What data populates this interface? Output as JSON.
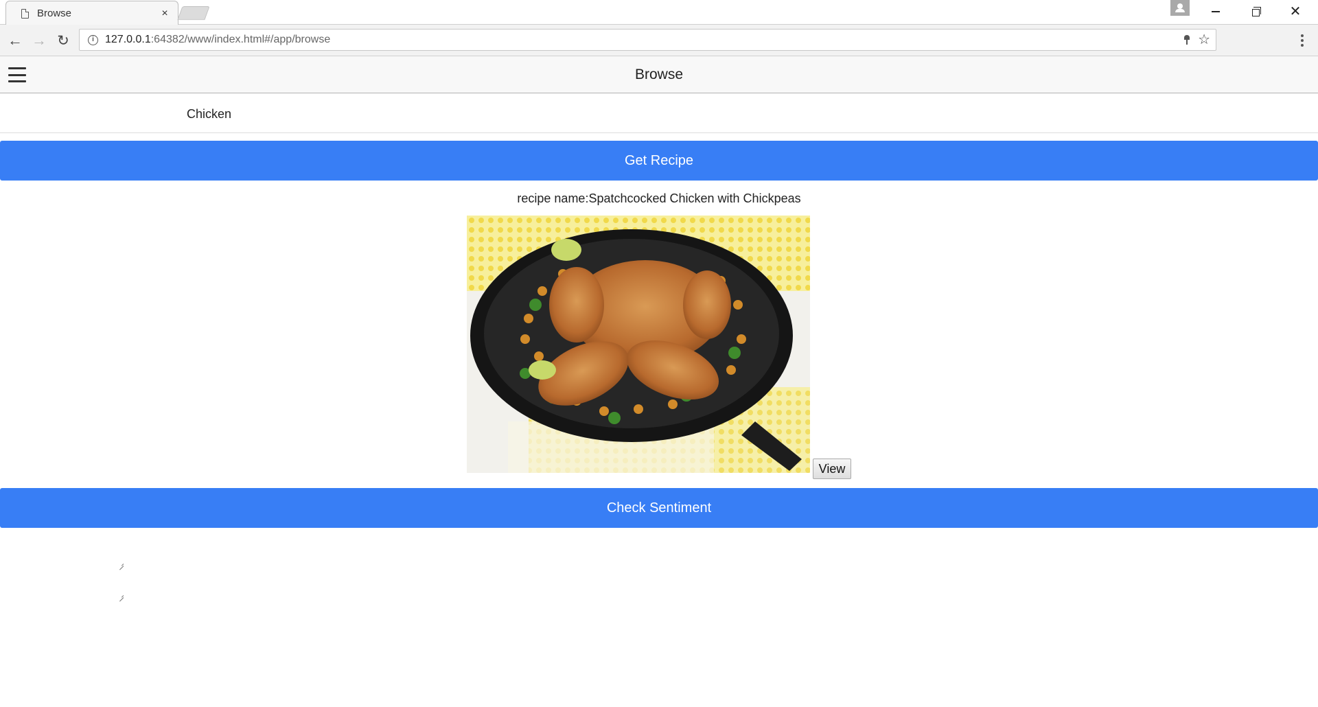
{
  "browser": {
    "tab_title": "Browse",
    "tab_close": "×",
    "url_host": "127.0.0.1",
    "url_rest": ":64382/www/index.html#/app/browse",
    "info_glyph": "i",
    "star_glyph": "☆",
    "back_glyph": "←",
    "forward_glyph": "→",
    "reload_glyph": "↻",
    "close_glyph": "✕"
  },
  "header": {
    "title": "Browse"
  },
  "search": {
    "value": "Chicken"
  },
  "buttons": {
    "get_recipe": "Get Recipe",
    "check_sentiment": "Check Sentiment",
    "view": "View"
  },
  "recipe": {
    "name_text": "recipe name:Spatchcocked Chicken with Chickpeas"
  },
  "colors": {
    "button_blue": "#387ef5",
    "header_bg": "#f8f8f8"
  }
}
